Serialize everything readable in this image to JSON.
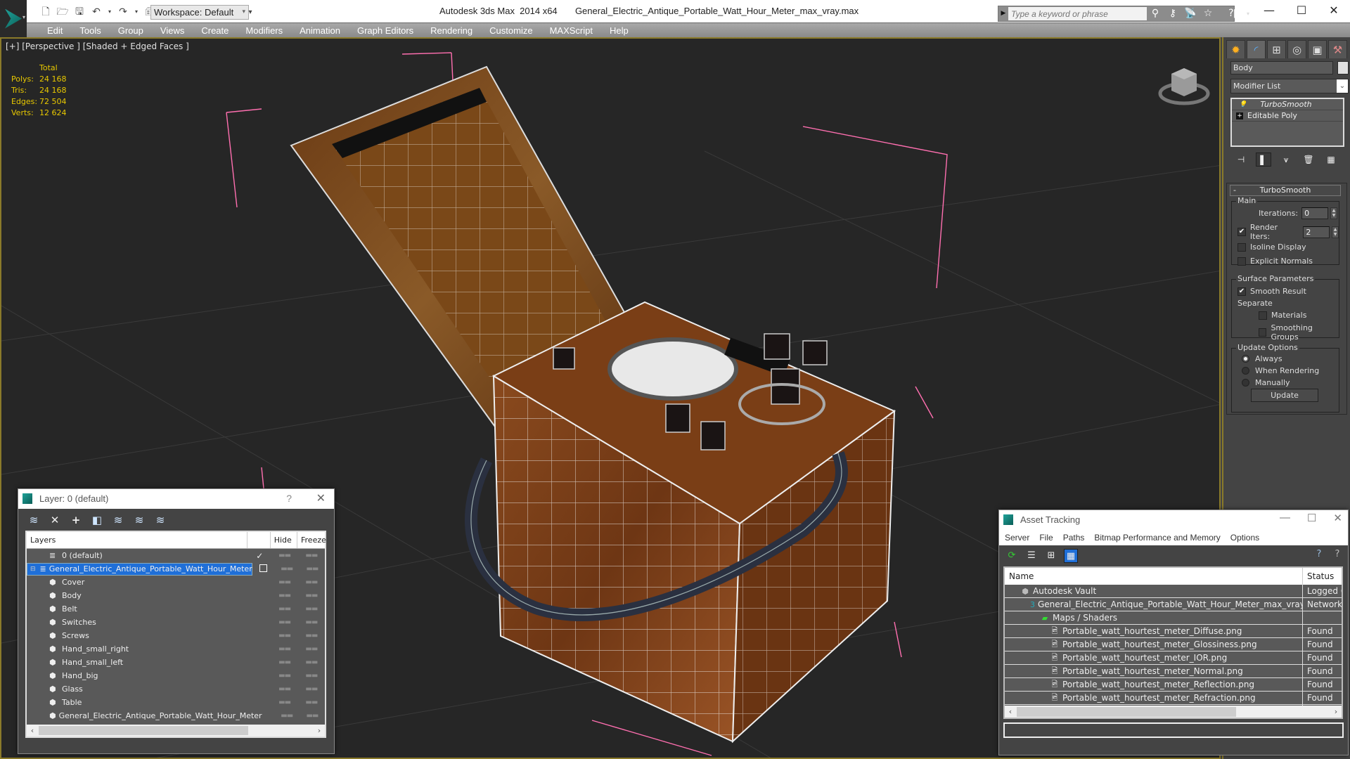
{
  "titlebar": {
    "workspace_label": "Workspace: Default",
    "window_title": "Autodesk 3ds Max  2014 x64       General_Electric_Antique_Portable_Watt_Hour_Meter_max_vray.max",
    "search_placeholder": "Type a keyword or phrase",
    "icons": [
      "new-file-icon",
      "open-folder-icon",
      "save-icon",
      "undo-icon",
      "redo-icon",
      "project-folder-icon"
    ],
    "search_tools": [
      "binoculars-icon",
      "key-icon",
      "satellite-icon",
      "star-icon",
      "help-icon"
    ]
  },
  "menubar": {
    "items": [
      "Edit",
      "Tools",
      "Group",
      "Views",
      "Create",
      "Modifiers",
      "Animation",
      "Graph Editors",
      "Rendering",
      "Customize",
      "MAXScript",
      "Help"
    ]
  },
  "viewport": {
    "label": "[+] [Perspective ] [Shaded + Edged Faces ]",
    "stats": {
      "header": "Total",
      "rows": [
        {
          "label": "Polys:",
          "value": "24 168"
        },
        {
          "label": "Tris:",
          "value": "24 168"
        },
        {
          "label": "Edges:",
          "value": "72 504"
        },
        {
          "label": "Verts:",
          "value": "12 624"
        }
      ]
    },
    "stats_color": "#e8c800",
    "border_color": "#8a7a2a"
  },
  "command_panel": {
    "object_name": "Body",
    "modifier_list": "Modifier List",
    "stack": [
      {
        "label": "TurboSmooth",
        "icon": "lightbulb-icon"
      },
      {
        "label": "Editable Poly",
        "icon": "plus-box-icon"
      }
    ],
    "turbosmooth": {
      "title": "TurboSmooth",
      "main_label": "Main",
      "iterations_label": "Iterations:",
      "iterations_value": "0",
      "render_iters_label": "Render Iters:",
      "render_iters_value": "2",
      "render_iters_checked": true,
      "isoline_label": "Isoline Display",
      "isoline_checked": false,
      "explicit_normals_label": "Explicit Normals",
      "explicit_normals_checked": false,
      "surface_label": "Surface Parameters",
      "smooth_result_label": "Smooth Result",
      "smooth_result_checked": true,
      "separate_label": "Separate",
      "materials_label": "Materials",
      "smoothing_groups_label": "Smoothing Groups",
      "update_options_label": "Update Options",
      "always_label": "Always",
      "when_rendering_label": "When Rendering",
      "manually_label": "Manually",
      "selected_update_option": "Always",
      "update_button": "Update"
    }
  },
  "layer_dialog": {
    "title": "Layer: 0 (default)",
    "help": "?",
    "columns": [
      "Layers",
      "",
      "Hide",
      "Freeze"
    ],
    "rows": [
      {
        "name": "0 (default)",
        "type": "layer",
        "current": "✓"
      },
      {
        "name": "General_Electric_Antique_Portable_Watt_Hour_Meter",
        "type": "layer",
        "selected": true,
        "expanded": true
      },
      {
        "name": "Cover",
        "type": "object"
      },
      {
        "name": "Body",
        "type": "object"
      },
      {
        "name": "Belt",
        "type": "object"
      },
      {
        "name": "Switches",
        "type": "object"
      },
      {
        "name": "Screws",
        "type": "object"
      },
      {
        "name": "Hand_small_right",
        "type": "object"
      },
      {
        "name": "Hand_small_left",
        "type": "object"
      },
      {
        "name": "Hand_big",
        "type": "object"
      },
      {
        "name": "Glass",
        "type": "object"
      },
      {
        "name": "Table",
        "type": "object"
      },
      {
        "name": "General_Electric_Antique_Portable_Watt_Hour_Meter",
        "type": "object"
      }
    ],
    "selection_color": "#1f6fd8"
  },
  "asset_dialog": {
    "title": "Asset Tracking",
    "menu": [
      "Server",
      "File",
      "Paths",
      "Bitmap Performance and Memory",
      "Options"
    ],
    "columns": [
      "Name",
      "Status"
    ],
    "rows": [
      {
        "name": "Autodesk Vault",
        "status": "Logged Out",
        "level": 1,
        "icon": "vault-icon"
      },
      {
        "name": "General_Electric_Antique_Portable_Watt_Hour_Meter_max_vray.max",
        "status": "Network",
        "level": 2,
        "icon": "max-file-icon"
      },
      {
        "name": "Maps / Shaders",
        "status": "",
        "level": 3,
        "icon": "maps-icon"
      },
      {
        "name": "Portable_watt_hourtest_meter_Diffuse.png",
        "status": "Found",
        "level": 4,
        "icon": "image-file-icon"
      },
      {
        "name": "Portable_watt_hourtest_meter_Glossiness.png",
        "status": "Found",
        "level": 4,
        "icon": "image-file-icon"
      },
      {
        "name": "Portable_watt_hourtest_meter_IOR.png",
        "status": "Found",
        "level": 4,
        "icon": "image-file-icon"
      },
      {
        "name": "Portable_watt_hourtest_meter_Normal.png",
        "status": "Found",
        "level": 4,
        "icon": "image-file-icon"
      },
      {
        "name": "Portable_watt_hourtest_meter_Reflection.png",
        "status": "Found",
        "level": 4,
        "icon": "image-file-icon"
      },
      {
        "name": "Portable_watt_hourtest_meter_Refraction.png",
        "status": "Found",
        "level": 4,
        "icon": "image-file-icon"
      }
    ]
  }
}
